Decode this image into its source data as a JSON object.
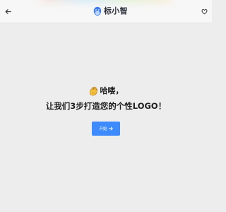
{
  "header": {
    "brand_name": "标小智",
    "back_icon": "back-arrow-icon",
    "favorite_icon": "heart-outline-icon",
    "logo_icon": "brand-logo-icon"
  },
  "main": {
    "greeting_icon": "waving-hand-emoji-icon",
    "greeting": "哈喽，",
    "headline": "让我们3步打造您的个性LOGO！",
    "start_button": {
      "label": "开始",
      "icon": "arrow-right-icon"
    }
  },
  "colors": {
    "page_background": "#ededed",
    "header_background": "#f7f7f7",
    "primary_button": "#3d8bfd",
    "text_dark": "#1f1f1f"
  }
}
